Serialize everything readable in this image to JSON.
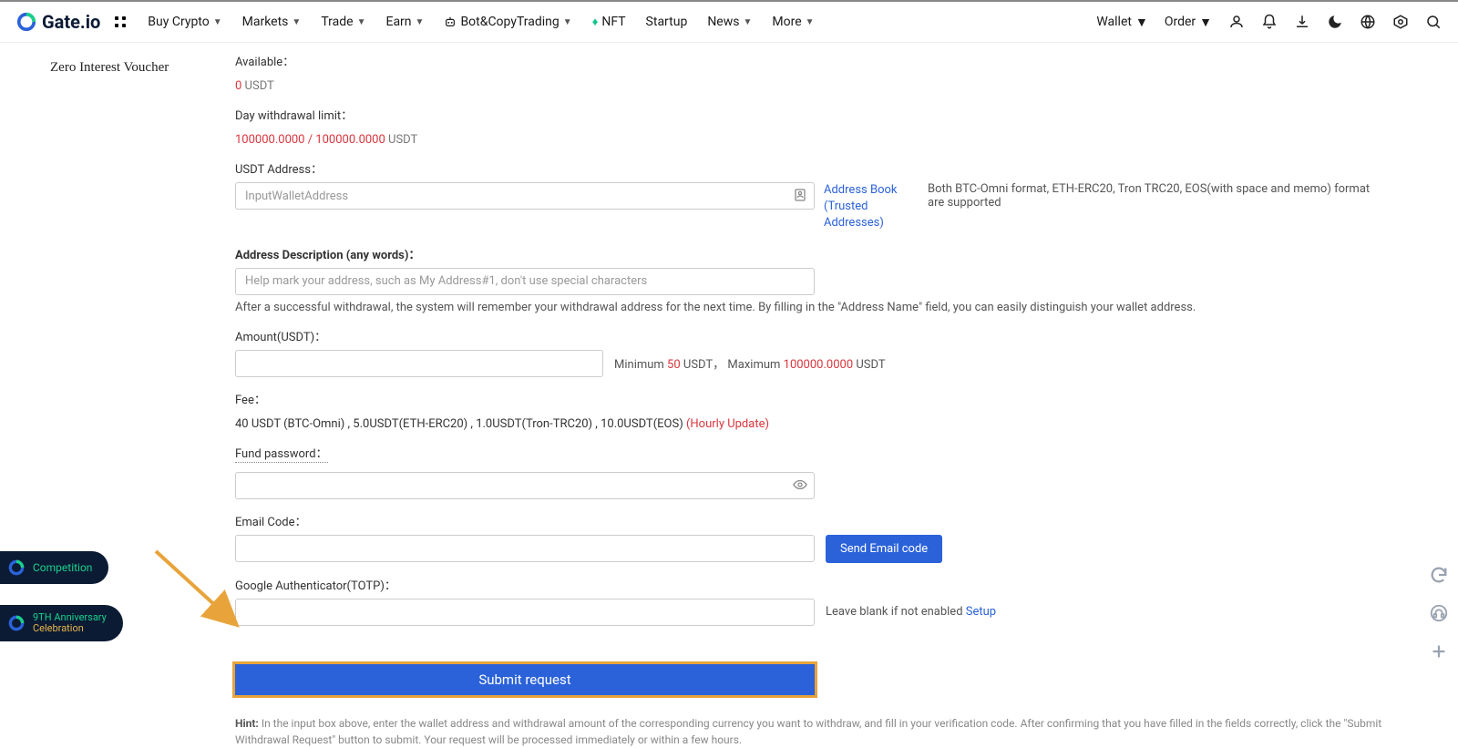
{
  "brand": "Gate.io",
  "nav": {
    "buy": "Buy Crypto",
    "markets": "Markets",
    "trade": "Trade",
    "earn": "Earn",
    "botcopy": "Bot&CopyTrading",
    "nft": "NFT",
    "startup": "Startup",
    "news": "News",
    "more": "More"
  },
  "header_right": {
    "wallet": "Wallet",
    "order": "Order"
  },
  "sidebar": {
    "voucher": "Zero Interest Voucher"
  },
  "form": {
    "available_label": "Available：",
    "available_value": "0",
    "available_unit": "USDT",
    "daylimit_label": "Day withdrawal limit：",
    "daylimit_value": "100000.0000 / 100000.0000",
    "daylimit_unit": "USDT",
    "addr_label": "USDT Address：",
    "addr_placeholder": "InputWalletAddress",
    "addr_book": "Address Book",
    "trusted": "(Trusted Addresses)",
    "addr_note": "Both BTC-Omni format, ETH-ERC20, Tron TRC20, EOS(with space and memo) format are supported",
    "desc_label": "Address Description (any words)：",
    "desc_placeholder": "Help mark your address, such as My Address#1, don't use special characters",
    "desc_helper": "After a successful withdrawal, the system will remember your withdrawal address for the next time. By filling in the \"Address Name\" field, you can easily distinguish your wallet address.",
    "amount_label": "Amount(USDT)：",
    "amount_min_pref": "Minimum ",
    "amount_min": "50",
    "amount_min_unit": " USDT，",
    "amount_max_pref": "Maximum ",
    "amount_max": "100000.0000",
    "amount_max_unit": " USDT",
    "fee_label": "Fee：",
    "fee_value": "40 USDT (BTC-Omni) , 5.0USDT(ETH-ERC20) , 1.0USDT(Tron-TRC20) , 10.0USDT(EOS) ",
    "fee_update": "(Hourly Update)",
    "fundpw_label": "Fund password：",
    "email_label": "Email Code：",
    "send_email": "Send Email code",
    "totp_label": "Google Authenticator(TOTP)：",
    "totp_side": "Leave blank if not enabled ",
    "totp_setup": "Setup",
    "submit": "Submit request",
    "hint_label": "Hint: ",
    "hint_text": "In the input box above, enter the wallet address and withdrawal amount of the corresponding currency you want to withdraw, and fill in your verification code. After confirming that you have filled in the fields correctly, click the \"Submit Withdrawal Request\" button to submit. Your request will be processed immediately or within a few hours."
  },
  "pills": {
    "competition": "Competition",
    "anni_top": "9TH Anniversary",
    "anni_bottom": "Celebration"
  }
}
